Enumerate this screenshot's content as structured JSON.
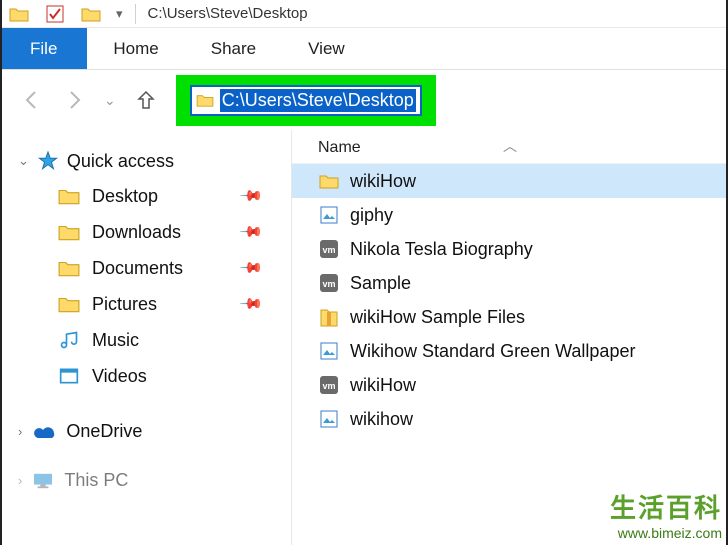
{
  "titlebar": {
    "title": "C:\\Users\\Steve\\Desktop"
  },
  "ribbon": {
    "file": "File",
    "tabs": [
      "Home",
      "Share",
      "View"
    ]
  },
  "address": {
    "path": "C:\\Users\\Steve\\Desktop"
  },
  "nav": {
    "quick_access": "Quick access",
    "items": [
      {
        "label": "Desktop",
        "icon": "folder",
        "pinned": true
      },
      {
        "label": "Downloads",
        "icon": "folder",
        "pinned": true
      },
      {
        "label": "Documents",
        "icon": "folder",
        "pinned": true
      },
      {
        "label": "Pictures",
        "icon": "folder",
        "pinned": true
      },
      {
        "label": "Music",
        "icon": "music",
        "pinned": false
      },
      {
        "label": "Videos",
        "icon": "video",
        "pinned": false
      }
    ],
    "onedrive": "OneDrive",
    "thispc": "This PC"
  },
  "content": {
    "column_header": "Name",
    "items": [
      {
        "label": "wikiHow",
        "icon": "folder",
        "selected": true
      },
      {
        "label": "giphy",
        "icon": "image"
      },
      {
        "label": "Nikola Tesla Biography",
        "icon": "vm"
      },
      {
        "label": "Sample",
        "icon": "vm"
      },
      {
        "label": "wikiHow Sample Files",
        "icon": "zip"
      },
      {
        "label": "Wikihow Standard Green Wallpaper",
        "icon": "image"
      },
      {
        "label": "wikiHow",
        "icon": "vm"
      },
      {
        "label": "wikihow",
        "icon": "image"
      }
    ]
  },
  "watermark": {
    "cn": "生活百科",
    "url": "www.bimeiz.com"
  },
  "colors": {
    "accent": "#1976d2",
    "highlight": "#00e000",
    "selection": "#cfe7fb"
  }
}
